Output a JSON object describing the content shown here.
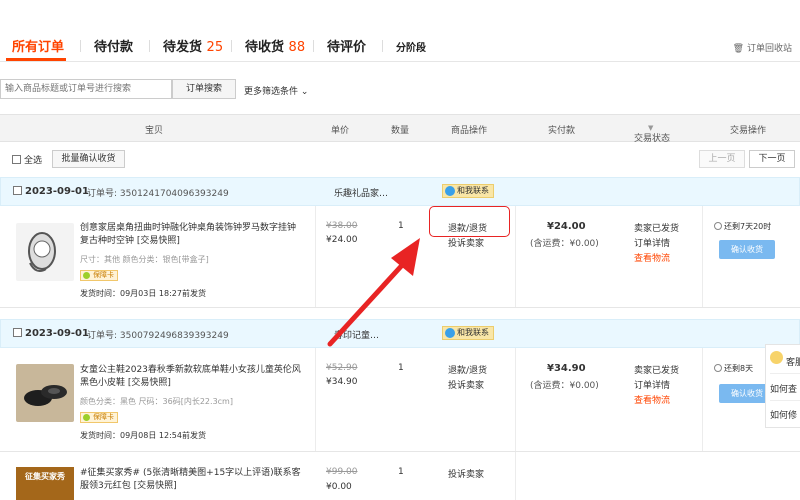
{
  "tabs": [
    {
      "label": "所有订单",
      "count": ""
    },
    {
      "label": "待付款",
      "count": ""
    },
    {
      "label": "待发货",
      "count": "25"
    },
    {
      "label": "待收货",
      "count": "88"
    },
    {
      "label": "待评价",
      "count": ""
    },
    {
      "label": "分阶段",
      "count": ""
    }
  ],
  "recycle_bin": "订单回收站",
  "search": {
    "placeholder": "输入商品标题或订单号进行搜索",
    "button": "订单搜索",
    "more_filters": "更多筛选条件"
  },
  "columns": {
    "item": "宝贝",
    "price": "单价",
    "qty": "数量",
    "ops": "商品操作",
    "paid": "实付款",
    "status": "交易状态",
    "actions": "交易操作"
  },
  "toolbar": {
    "select_all": "全选",
    "batch_confirm": "批量确认收货",
    "prev": "上一页",
    "next": "下一页"
  },
  "contact_label": "和我联系",
  "orders": [
    {
      "date": "2023-09-01",
      "order_no": "订单号: 3501241704096393249",
      "shop": "乐趣礼品家…",
      "title": "创意家居桌角扭曲时钟融化钟桌角装饰钟罗马数字挂钟复古种时空钟 [交易快照]",
      "specs": "尺寸：其他  颜色分类：银色[带盒子]",
      "badge": "保障卡",
      "ship": "发货时间：09月03日 18:27前发货",
      "orig_price": "¥38.00",
      "price": "¥24.00",
      "qty": "1",
      "op1": "退款/退货",
      "op2": "投诉卖家",
      "paid": "¥24.00",
      "ship_fee": "(含运费：¥0.00)",
      "status1": "卖家已发货",
      "status2": "订单详情",
      "status3": "查看物流",
      "remaining": "还剩7天20时",
      "confirm": "确认收货"
    },
    {
      "date": "2023-09-01",
      "order_no": "订单号: 3500792496839393249",
      "shop": "春印记童…",
      "title": "女童公主鞋2023春秋季新款软底单鞋小女孩儿童英伦风黑色小皮鞋 [交易快照]",
      "specs": "颜色分类：黑色  尺码：36码[内长22.3cm]",
      "badge": "保障卡",
      "ship": "发货时间：09月08日 12:54前发货",
      "orig_price": "¥52.90",
      "price": "¥34.90",
      "qty": "1",
      "op1": "退款/退货",
      "op2": "投诉卖家",
      "paid": "¥34.90",
      "ship_fee": "(含运费：¥0.00)",
      "status1": "卖家已发货",
      "status2": "订单详情",
      "status3": "查看物流",
      "remaining": "还剩8天",
      "confirm": "确认收货"
    },
    {
      "collect_badge": "征集买家秀",
      "title": "#征集买家秀# (5张清晰精美图+15字以上评语)联系客服领3元红包 [交易快照]",
      "orig_price": "¥99.00",
      "price": "¥0.00",
      "qty": "1",
      "op2": "投诉卖家"
    }
  ],
  "float_panel": {
    "title": "客服",
    "q1": "如何查",
    "q2": "如何修"
  },
  "colors": {
    "accent": "#ff4400",
    "highlight": "#e82424",
    "button_blue": "#7ab9f0"
  }
}
